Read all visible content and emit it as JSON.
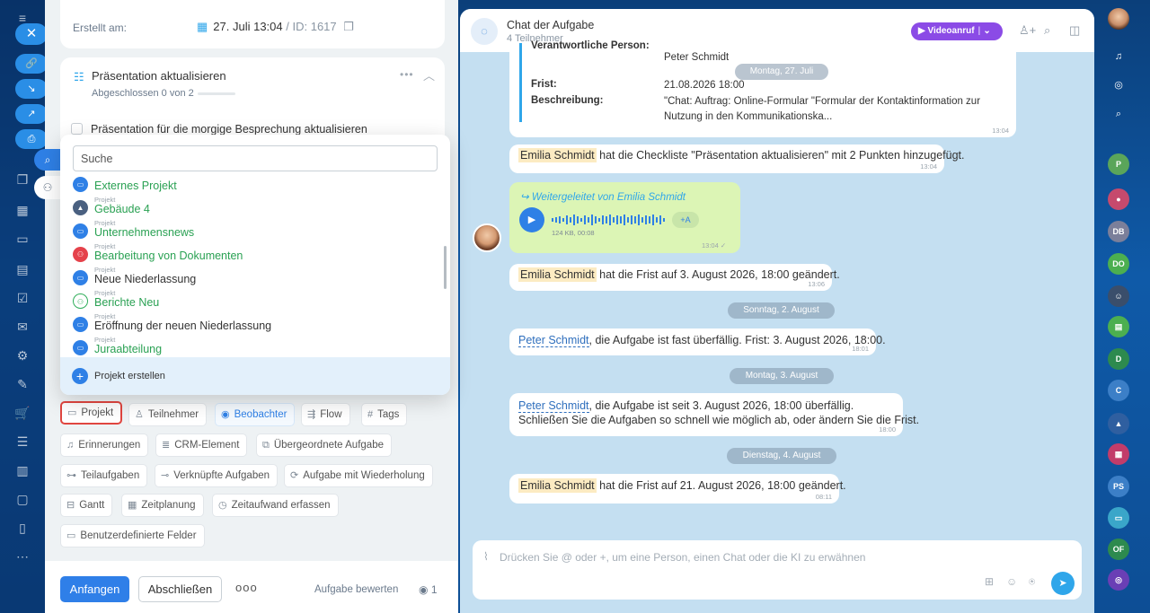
{
  "task": {
    "created_label": "Erstellt am:",
    "created_value": "27. Juli 13:04",
    "id_text": "ID: 1617",
    "checklist": {
      "title": "Präsentation aktualisieren",
      "progress": "Abgeschlossen 0 von 2",
      "progress_fraction": 0,
      "item": "Präsentation für die morgige Besprechung aktualisieren"
    },
    "project_dropdown": {
      "search_placeholder": "Suche",
      "projects": [
        {
          "kind": "",
          "name": "Externes Projekt",
          "icon": "folder-icon",
          "color": "green"
        },
        {
          "kind": "Projekt",
          "name": "Gebäude 4",
          "icon": "building-image-icon",
          "color": "green"
        },
        {
          "kind": "Projekt",
          "name": "Unternehmensnews",
          "icon": "folder-icon",
          "color": "green"
        },
        {
          "kind": "Projekt",
          "name": "Bearbeitung von Dokumenten",
          "icon": "group-icon",
          "color": "green"
        },
        {
          "kind": "Projekt",
          "name": "Neue Niederlassung",
          "icon": "folder-icon",
          "color": "default"
        },
        {
          "kind": "Projekt",
          "name": "Berichte Neu",
          "icon": "group-outline-icon",
          "color": "green"
        },
        {
          "kind": "Projekt",
          "name": "Eröffnung der neuen Niederlassung",
          "icon": "folder-icon",
          "color": "default"
        },
        {
          "kind": "Projekt",
          "name": "Juraabteilung",
          "icon": "folder-icon",
          "color": "green"
        }
      ],
      "create_label": "Projekt erstellen"
    },
    "fields": {
      "projekt": "Projekt",
      "teilnehmer": "Teilnehmer",
      "beobachter": "Beobachter",
      "flow": "Flow",
      "tags": "Tags",
      "erinnerungen": "Erinnerungen",
      "crm": "CRM-Element",
      "parent": "Übergeordnete Aufgabe",
      "subtasks": "Teilaufgaben",
      "linked": "Verknüpfte Aufgaben",
      "recurring": "Aufgabe mit Wiederholung",
      "gantt": "Gantt",
      "planning": "Zeitplanung",
      "time": "Zeitaufwand erfassen",
      "custom": "Benutzerdefinierte Felder"
    },
    "footer": {
      "start": "Anfangen",
      "finish": "Abschließen",
      "more": "ooo",
      "rate": "Aufgabe bewerten",
      "viewers": "1"
    }
  },
  "chat": {
    "title": "Chat der Aufgabe",
    "members": "4 Teilnehmer",
    "video_call": "Videoanruf",
    "task_card": {
      "responsible_label": "Verantwortliche Person:",
      "responsible_value": "Peter Schmidt",
      "deadline_label": "Frist:",
      "deadline_value": "21.08.2026 18:00",
      "description_label": "Beschreibung:",
      "description_value": "\"Chat: Auftrag: Online-Formular \"Formular der Kontaktinformation zur Nutzung in den Kommunikationska...",
      "time": "13:04"
    },
    "dates": {
      "d1": "Montag, 27. Juli",
      "d2": "Sonntag, 2. August",
      "d3": "Montag, 3. August",
      "d4": "Dienstag, 4. August"
    },
    "messages": {
      "m1_name": "Emilia Schmidt",
      "m1_text": "hat die Checkliste \"Präsentation aktualisieren\" mit 2 Punkten hinzugefügt.",
      "m1_time": "13:04",
      "fwd_title": "Weitergeleitet von Emilia Schmidt",
      "fwd_meta": "124 KB, 00:08",
      "fwd_transcribe": "+A",
      "fwd_time": "13:04 ✓",
      "m2_name": "Emilia Schmidt",
      "m2_text": "hat die Frist auf 3. August 2026, 18:00 geändert.",
      "m2_time": "13:06",
      "m3_name": "Peter Schmidt",
      "m3_text": ", die Aufgabe ist fast überfällig. Frist: 3. August 2026, 18:00.",
      "m3_time": "18:01",
      "m4_name": "Peter Schmidt",
      "m4_text": ", die Aufgabe ist seit 3. August 2026, 18:00 überfällig.",
      "m4_text2": "Schließen Sie die Aufgaben so schnell wie möglich ab, oder ändern Sie die Frist.",
      "m4_time": "18:00",
      "m5_name": "Emilia Schmidt",
      "m5_text": "hat die Frist auf 21. August 2026, 18:00 geändert.",
      "m5_time": "08:11"
    },
    "composer_placeholder": "Drücken Sie @ oder +, um eine Person, einen Chat oder die KI zu erwähnen"
  },
  "right_rail": {
    "avatars": [
      "P",
      "DB",
      "DO",
      "D",
      "C",
      "PS",
      "OF"
    ]
  },
  "colors": {
    "accent": "#2f80e6",
    "green_text": "#2aa153",
    "video": "#8b4be6",
    "highlight_border": "#e0453f"
  }
}
